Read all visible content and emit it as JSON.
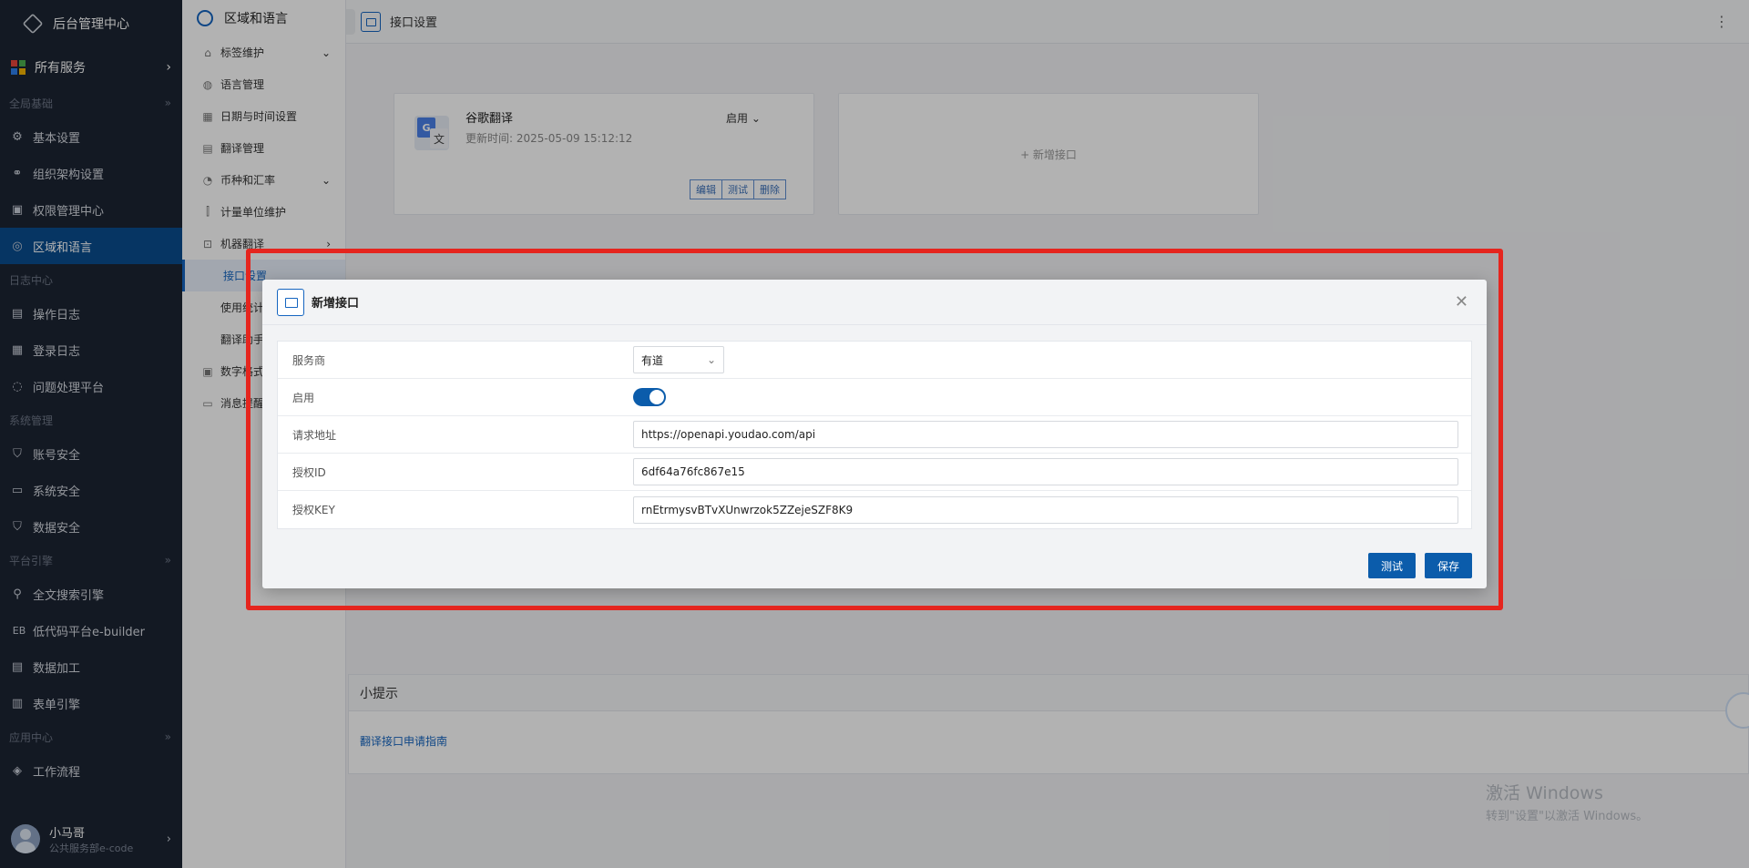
{
  "nav": {
    "brand": "后台管理中心",
    "all_services": "所有服务",
    "sections": [
      {
        "title": "全局基础",
        "items": [
          {
            "label": "基本设置",
            "icon": "gear-icon"
          },
          {
            "label": "组织架构设置",
            "icon": "org-icon"
          },
          {
            "label": "权限管理中心",
            "icon": "permission-icon"
          },
          {
            "label": "区域和语言",
            "icon": "globe-icon",
            "active": true
          }
        ]
      },
      {
        "title": "日志中心",
        "items": [
          {
            "label": "操作日志",
            "icon": "log-icon"
          },
          {
            "label": "登录日志",
            "icon": "login-log-icon"
          },
          {
            "label": "问题处理平台",
            "icon": "planet-icon"
          }
        ]
      },
      {
        "title": "系统管理",
        "items": [
          {
            "label": "账号安全",
            "icon": "shield-icon"
          },
          {
            "label": "系统安全",
            "icon": "monitor-icon"
          },
          {
            "label": "数据安全",
            "icon": "data-shield-icon"
          }
        ]
      },
      {
        "title": "平台引擎",
        "items": [
          {
            "label": "全文搜索引擎",
            "icon": "search-icon"
          },
          {
            "label": "低代码平台e-builder",
            "icon": "eb-icon",
            "prefix": "EB"
          },
          {
            "label": "数据加工",
            "icon": "data-process-icon"
          },
          {
            "label": "表单引擎",
            "icon": "form-icon"
          }
        ]
      },
      {
        "title": "应用中心",
        "items": [
          {
            "label": "工作流程",
            "icon": "workflow-icon"
          }
        ]
      }
    ],
    "user": {
      "name": "小马哥",
      "dept": "公共服务部e-code"
    }
  },
  "subnav": {
    "title": "区域和语言",
    "items": [
      {
        "label": "标签维护",
        "icon": "tag-icon",
        "arrow": "down"
      },
      {
        "label": "语言管理",
        "icon": "language-icon"
      },
      {
        "label": "日期与时间设置",
        "icon": "calendar-icon"
      },
      {
        "label": "翻译管理",
        "icon": "translate-icon"
      },
      {
        "label": "币种和汇率",
        "icon": "currency-icon",
        "arrow": "down"
      },
      {
        "label": "计量单位维护",
        "icon": "unit-icon"
      },
      {
        "label": "机器翻译",
        "icon": "robot-icon",
        "arrow": "right"
      },
      {
        "label": "接口设置",
        "child": true,
        "selected": true
      },
      {
        "label": "使用统计",
        "child": true
      },
      {
        "label": "翻译助手",
        "child": true
      },
      {
        "label": "数字格式",
        "icon": "number-icon"
      },
      {
        "label": "消息提醒",
        "icon": "message-icon"
      }
    ]
  },
  "topbar": {
    "title": "接口设置"
  },
  "google_card": {
    "title": "谷歌翻译",
    "updated": "更新时间: 2025-05-09 15:12:12",
    "status": "启用",
    "buttons": [
      "编辑",
      "测试",
      "删除"
    ]
  },
  "add_card": {
    "label": "+ 新增接口"
  },
  "tips": {
    "title": "小提示",
    "link": "翻译接口申请指南"
  },
  "watermark": {
    "line1": "激活 Windows",
    "line2": "转到\"设置\"以激活 Windows。"
  },
  "dialog": {
    "title": "新增接口",
    "fields": {
      "provider_label": "服务商",
      "provider_value": "有道",
      "enabled_label": "启用",
      "enabled": true,
      "url_label": "请求地址",
      "url_value": "https://openapi.youdao.com/api",
      "id_label": "授权ID",
      "id_value": "6df64a76fc867e15",
      "key_label": "授权KEY",
      "key_value": "rnEtrmysvBTvXUnwrzok5ZZejeSZF8K9"
    },
    "test_label": "测试",
    "save_label": "保存"
  },
  "colors": {
    "nav_bg": "#1c2433",
    "accent": "#0b5cab",
    "annotation": "#e5251e"
  }
}
